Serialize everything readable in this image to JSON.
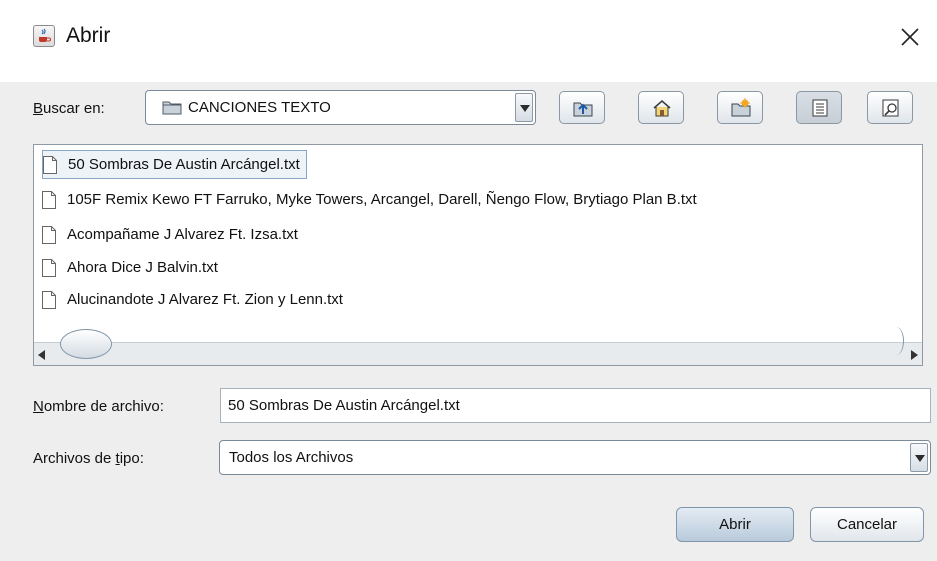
{
  "window": {
    "title": "Abrir",
    "app_icon": "java-cup-icon",
    "close_icon": "close-icon"
  },
  "lookin": {
    "label_mnemonic": "B",
    "label_rest": "uscar en:",
    "folder_icon": "folder-icon",
    "value": "CANCIONES TEXTO"
  },
  "toolbar": [
    {
      "name": "up-one-level-button",
      "icon": "folder-up-icon"
    },
    {
      "name": "home-button",
      "icon": "home-icon"
    },
    {
      "name": "new-folder-button",
      "icon": "new-folder-icon"
    },
    {
      "name": "list-view-button",
      "icon": "list-view-icon",
      "active": true
    },
    {
      "name": "details-view-button",
      "icon": "details-view-icon",
      "active": false
    }
  ],
  "files": [
    {
      "name": "50 Sombras De Austin Arcángel.txt",
      "selected": true
    },
    {
      "name": "105F Remix Kewo FT Farruko, Myke Towers, Arcangel, Darell, Ñengo Flow, Brytiago Plan B.txt",
      "selected": false
    },
    {
      "name": "Acompañame J Alvarez Ft. Izsa.txt",
      "selected": false
    },
    {
      "name": "Ahora Dice J Balvin.txt",
      "selected": false
    },
    {
      "name": "Alucinandote J Alvarez Ft. Zion y Lenn.txt",
      "selected": false
    }
  ],
  "filename": {
    "label_mnemonic": "N",
    "label_rest": "ombre de archivo:",
    "value": "50 Sombras De Austin Arcángel.txt"
  },
  "filetype": {
    "label_before": "Archivos de ",
    "label_mnemonic": "t",
    "label_after": "ipo:",
    "value": "Todos los Archivos"
  },
  "buttons": {
    "open": "Abrir",
    "cancel": "Cancelar"
  },
  "colors": {
    "selection_border": "#8aa6c4",
    "button_primary": "#b9cadb"
  }
}
